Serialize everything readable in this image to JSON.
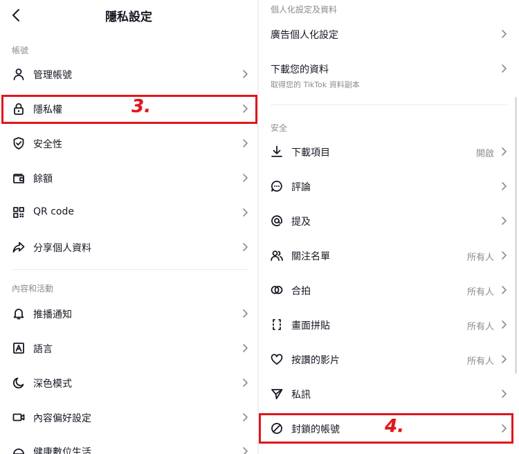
{
  "left": {
    "title": "隱私設定",
    "section_account": "帳號",
    "account_items": [
      {
        "label": "管理帳號",
        "icon": "person-icon"
      },
      {
        "label": "隱私權",
        "icon": "lock-icon"
      },
      {
        "label": "安全性",
        "icon": "shield-check-icon"
      },
      {
        "label": "餘額",
        "icon": "wallet-icon"
      },
      {
        "label": "QR code",
        "icon": "qr-code-icon"
      },
      {
        "label": "分享個人資料",
        "icon": "share-arrow-icon"
      }
    ],
    "section_content": "內容和活動",
    "content_items": [
      {
        "label": "推播通知",
        "icon": "bell-icon"
      },
      {
        "label": "語言",
        "icon": "language-icon"
      },
      {
        "label": "深色模式",
        "icon": "moon-icon"
      },
      {
        "label": "內容偏好設定",
        "icon": "video-icon"
      },
      {
        "label": "健康數位生活",
        "icon": "wellbeing-icon"
      }
    ],
    "step_label": "3."
  },
  "right": {
    "section_personalization": "個人化設定及資料",
    "personalization_items": [
      {
        "label": "廣告個人化設定"
      },
      {
        "label": "下載您的資料",
        "sublabel": "取得您的 TikTok 資料副本"
      }
    ],
    "section_safety": "安全",
    "safety_items": [
      {
        "label": "下載項目",
        "value": "開啟",
        "icon": "download-icon"
      },
      {
        "label": "評論",
        "value": "",
        "icon": "comment-icon"
      },
      {
        "label": "提及",
        "value": "",
        "icon": "at-sign-icon"
      },
      {
        "label": "關注名單",
        "value": "所有人",
        "icon": "people-icon"
      },
      {
        "label": "合拍",
        "value": "所有人",
        "icon": "duet-icon"
      },
      {
        "label": "畫面拼貼",
        "value": "所有人",
        "icon": "stitch-icon"
      },
      {
        "label": "按讚的影片",
        "value": "所有人",
        "icon": "heart-icon"
      },
      {
        "label": "私訊",
        "value": "",
        "icon": "send-icon"
      },
      {
        "label": "封鎖的帳號",
        "value": "",
        "icon": "block-icon"
      }
    ],
    "step_label": "4."
  },
  "colors": {
    "highlight": "#e0161d",
    "text_primary": "#161823",
    "text_secondary": "#8a8b91"
  }
}
